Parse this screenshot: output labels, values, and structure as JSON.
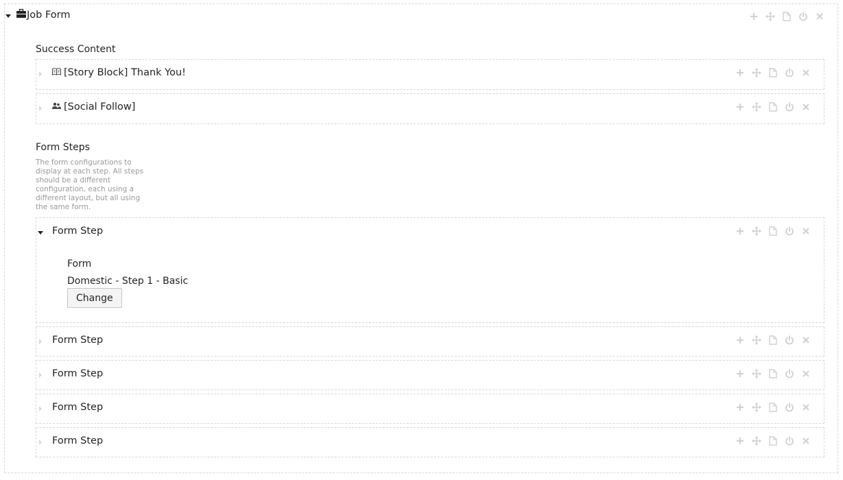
{
  "root": {
    "title": "Job Form"
  },
  "success_content": {
    "label": "Success Content",
    "items": [
      {
        "title": "[Story Block] Thank You!"
      },
      {
        "title": "[Social Follow]"
      }
    ]
  },
  "form_steps": {
    "label": "Form Steps",
    "description": "The form configurations to display at each step. All steps should be a different configuration, each using a different layout, but all using the same form.",
    "steps": [
      {
        "title": "Form Step",
        "form_label": "Form",
        "form_value": "Domestic - Step 1 - Basic",
        "change_label": "Change"
      },
      {
        "title": "Form Step"
      },
      {
        "title": "Form Step"
      },
      {
        "title": "Form Step"
      },
      {
        "title": "Form Step"
      }
    ]
  },
  "icons": [
    "add-icon",
    "move-icon",
    "copy-icon",
    "power-icon",
    "close-icon"
  ],
  "colors": {
    "action_icon": "#d0d0d0",
    "border": "#d6d6d6",
    "description": "#999999"
  }
}
